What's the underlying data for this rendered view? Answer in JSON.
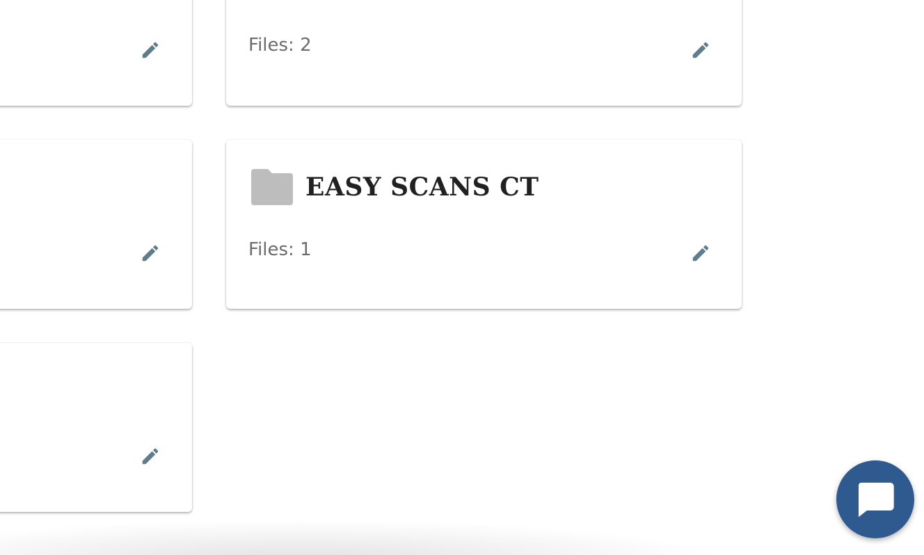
{
  "folders": [
    {
      "files_label": ""
    },
    {
      "files_label": "Files: 2"
    },
    {
      "files_label": ""
    },
    {
      "title": "EASY SCANS CT",
      "files_label": "Files: 1"
    },
    {
      "files_label": ""
    }
  ],
  "icons": {
    "edit": "pencil-icon",
    "folder": "folder-icon",
    "chat": "chat-bubble-icon"
  },
  "colors": {
    "edit_icon": "#607d8b",
    "folder_icon": "#bdbdbd",
    "title_text": "#212121",
    "files_text": "#6b6b6b",
    "chat_button": "#2f5a8f"
  }
}
